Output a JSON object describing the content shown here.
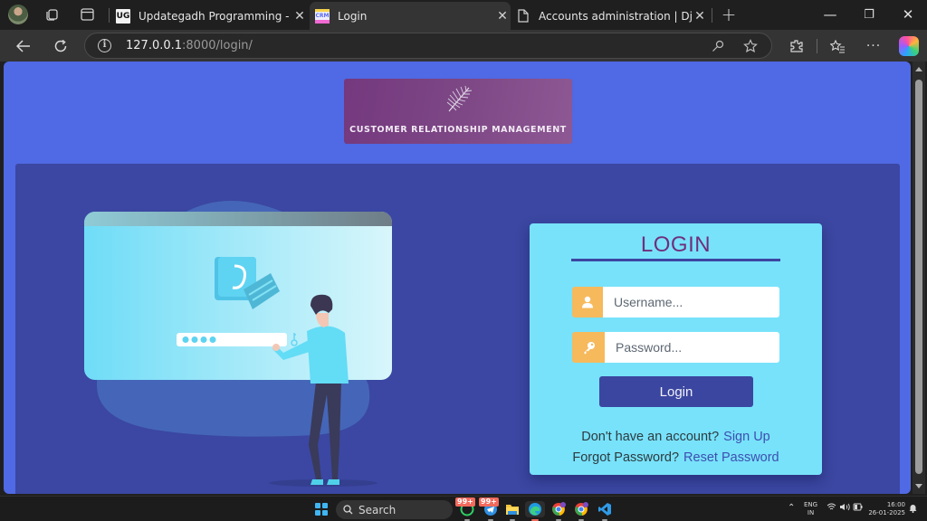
{
  "browser": {
    "tabs": [
      {
        "title": "Updategadh Programming - Updategadh",
        "favicon": "UG",
        "active": false
      },
      {
        "title": "Login",
        "favicon": "CRM",
        "active": true
      },
      {
        "title": "Accounts administration | Django site admin",
        "favicon": "document-icon",
        "active": false
      }
    ],
    "new_tab_label": "+",
    "address": {
      "host": "127.0.0.1",
      "rest": ":8000/login/"
    },
    "window_controls": {
      "minimize": "—",
      "restore": "❐",
      "close": "✕"
    }
  },
  "page": {
    "logo_caption": "CUSTOMER RELATIONSHIP MANAGEMENT",
    "login": {
      "heading": "LOGIN",
      "username_placeholder": "Username...",
      "password_placeholder": "Password...",
      "username_value": "",
      "password_value": "",
      "submit_label": "Login",
      "signup_prompt": "Don't have an account?",
      "signup_link": "Sign Up",
      "forgot_prompt": "Forgot Password?",
      "reset_link": "Reset Password"
    },
    "colors": {
      "page_bg": "#5069e4",
      "panel_bg": "#3b47a2",
      "card_bg": "#78e2fb",
      "heading": "#6f2f7c",
      "addon": "#f6b95c",
      "button": "#3b46a0"
    }
  },
  "taskbar": {
    "search_label": "Search",
    "badges": [
      "99+",
      "99+"
    ],
    "language": {
      "line1": "ENG",
      "line2": "IN"
    },
    "time": "16:00",
    "date": "26-01-2025"
  }
}
